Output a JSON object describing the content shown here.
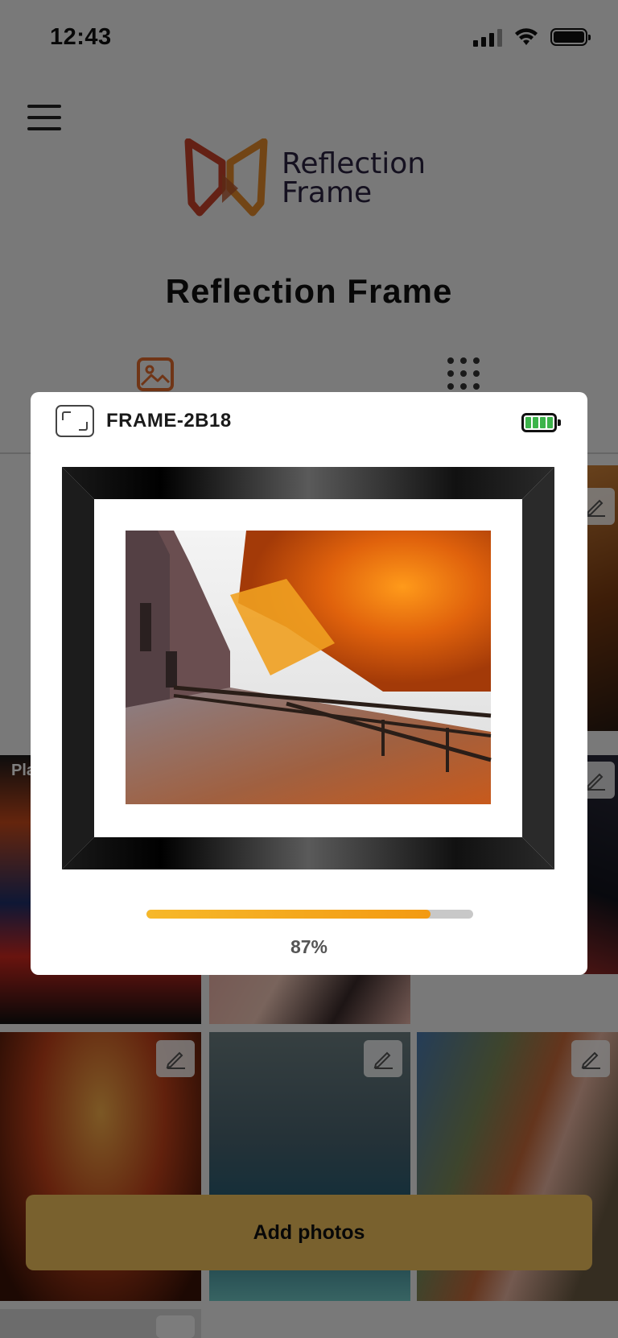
{
  "status_bar": {
    "time": "12:43"
  },
  "header": {
    "logo_text_line1": "Reflection",
    "logo_text_line2": "Frame",
    "title": "Reflection Frame"
  },
  "tabs": [
    {
      "name": "photos",
      "icon": "image-icon",
      "active": true
    },
    {
      "name": "grid",
      "icon": "grid-dots-icon",
      "active": false
    }
  ],
  "grid": {
    "tile_badge_text": "Pla"
  },
  "add_photos_label": "Add photos",
  "modal": {
    "frame_name": "FRAME-2B18",
    "battery_color": "#3cb44a",
    "upload_progress": 0.87,
    "progress_text": "87%"
  },
  "colors": {
    "accent_orange": "#e06a2c",
    "button_gold": "#f2c35d",
    "progress_fill": "#f39a12"
  }
}
